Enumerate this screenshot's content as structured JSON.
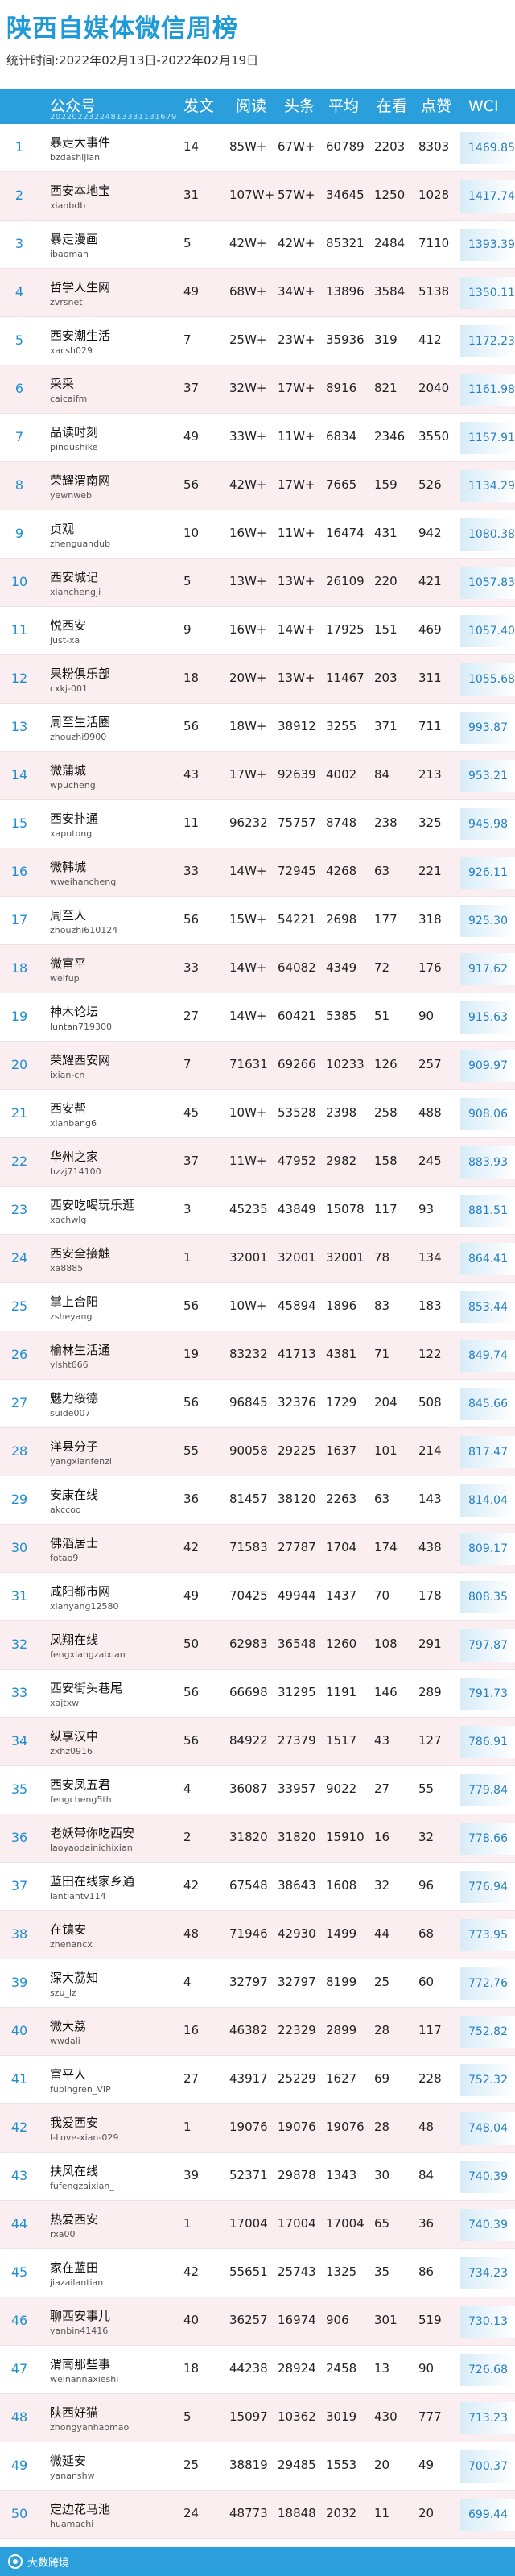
{
  "title": "陕西自媒体微信周榜",
  "subtitle": "统计时间:2022年02月13日-2022年02月19日",
  "header": {
    "account": "公众号",
    "account_sub": "20220223224813331131679",
    "posts": "发文",
    "reads": "阅读",
    "headline": "头条",
    "avg": "平均",
    "looking": "在看",
    "likes": "点赞",
    "wci": "WCI"
  },
  "rows": [
    {
      "rank": "1",
      "name": "暴走大事件",
      "id": "bzdashijian",
      "posts": "14",
      "reads": "85W+",
      "headline": "67W+",
      "avg": "60789",
      "looking": "2203",
      "likes": "8303",
      "wci": "1469.85"
    },
    {
      "rank": "2",
      "name": "西安本地宝",
      "id": "xianbdb",
      "posts": "31",
      "reads": "107W+",
      "headline": "57W+",
      "avg": "34645",
      "looking": "1250",
      "likes": "1028",
      "wci": "1417.74"
    },
    {
      "rank": "3",
      "name": "暴走漫画",
      "id": "ibaoman",
      "posts": "5",
      "reads": "42W+",
      "headline": "42W+",
      "avg": "85321",
      "looking": "2484",
      "likes": "7110",
      "wci": "1393.39"
    },
    {
      "rank": "4",
      "name": "哲学人生网",
      "id": "zvrsnet",
      "posts": "49",
      "reads": "68W+",
      "headline": "34W+",
      "avg": "13896",
      "looking": "3584",
      "likes": "5138",
      "wci": "1350.11"
    },
    {
      "rank": "5",
      "name": "西安潮生活",
      "id": "xacsh029",
      "posts": "7",
      "reads": "25W+",
      "headline": "23W+",
      "avg": "35936",
      "looking": "319",
      "likes": "412",
      "wci": "1172.23"
    },
    {
      "rank": "6",
      "name": "采采",
      "id": "caicaifm",
      "posts": "37",
      "reads": "32W+",
      "headline": "17W+",
      "avg": "8916",
      "looking": "821",
      "likes": "2040",
      "wci": "1161.98"
    },
    {
      "rank": "7",
      "name": "品读时刻",
      "id": "pindushike",
      "posts": "49",
      "reads": "33W+",
      "headline": "11W+",
      "avg": "6834",
      "looking": "2346",
      "likes": "3550",
      "wci": "1157.91"
    },
    {
      "rank": "8",
      "name": "荣耀渭南网",
      "id": "yewnweb",
      "posts": "56",
      "reads": "42W+",
      "headline": "17W+",
      "avg": "7665",
      "looking": "159",
      "likes": "526",
      "wci": "1134.29"
    },
    {
      "rank": "9",
      "name": "贞观",
      "id": "zhenguandub",
      "posts": "10",
      "reads": "16W+",
      "headline": "11W+",
      "avg": "16474",
      "looking": "431",
      "likes": "942",
      "wci": "1080.38"
    },
    {
      "rank": "10",
      "name": "西安城记",
      "id": "xianchengji",
      "posts": "5",
      "reads": "13W+",
      "headline": "13W+",
      "avg": "26109",
      "looking": "220",
      "likes": "421",
      "wci": "1057.83"
    },
    {
      "rank": "11",
      "name": "悦西安",
      "id": "just-xa",
      "posts": "9",
      "reads": "16W+",
      "headline": "14W+",
      "avg": "17925",
      "looking": "151",
      "likes": "469",
      "wci": "1057.40"
    },
    {
      "rank": "12",
      "name": "果粉俱乐部",
      "id": "cxkj-001",
      "posts": "18",
      "reads": "20W+",
      "headline": "13W+",
      "avg": "11467",
      "looking": "203",
      "likes": "311",
      "wci": "1055.68"
    },
    {
      "rank": "13",
      "name": "周至生活圈",
      "id": "zhouzhi9900",
      "posts": "56",
      "reads": "18W+",
      "headline": "38912",
      "avg": "3255",
      "looking": "371",
      "likes": "711",
      "wci": "993.87"
    },
    {
      "rank": "14",
      "name": "微蒲城",
      "id": "wpucheng",
      "posts": "43",
      "reads": "17W+",
      "headline": "92639",
      "avg": "4002",
      "looking": "84",
      "likes": "213",
      "wci": "953.21"
    },
    {
      "rank": "15",
      "name": "西安扑通",
      "id": "xaputong",
      "posts": "11",
      "reads": "96232",
      "headline": "75757",
      "avg": "8748",
      "looking": "238",
      "likes": "325",
      "wci": "945.98"
    },
    {
      "rank": "16",
      "name": "微韩城",
      "id": "wweihancheng",
      "posts": "33",
      "reads": "14W+",
      "headline": "72945",
      "avg": "4268",
      "looking": "63",
      "likes": "221",
      "wci": "926.11"
    },
    {
      "rank": "17",
      "name": "周至人",
      "id": "zhouzhi610124",
      "posts": "56",
      "reads": "15W+",
      "headline": "54221",
      "avg": "2698",
      "looking": "177",
      "likes": "318",
      "wci": "925.30"
    },
    {
      "rank": "18",
      "name": "微富平",
      "id": "weifup",
      "posts": "33",
      "reads": "14W+",
      "headline": "64082",
      "avg": "4349",
      "looking": "72",
      "likes": "176",
      "wci": "917.62"
    },
    {
      "rank": "19",
      "name": "神木论坛",
      "id": "luntan719300",
      "posts": "27",
      "reads": "14W+",
      "headline": "60421",
      "avg": "5385",
      "looking": "51",
      "likes": "90",
      "wci": "915.63"
    },
    {
      "rank": "20",
      "name": "荣耀西安网",
      "id": "ixian-cn",
      "posts": "7",
      "reads": "71631",
      "headline": "69266",
      "avg": "10233",
      "looking": "126",
      "likes": "257",
      "wci": "909.97"
    },
    {
      "rank": "21",
      "name": "西安帮",
      "id": "xianbang6",
      "posts": "45",
      "reads": "10W+",
      "headline": "53528",
      "avg": "2398",
      "looking": "258",
      "likes": "488",
      "wci": "908.06"
    },
    {
      "rank": "22",
      "name": "华州之家",
      "id": "hzzj714100",
      "posts": "37",
      "reads": "11W+",
      "headline": "47952",
      "avg": "2982",
      "looking": "158",
      "likes": "245",
      "wci": "883.93"
    },
    {
      "rank": "23",
      "name": "西安吃喝玩乐逛",
      "id": "xachwlg",
      "posts": "3",
      "reads": "45235",
      "headline": "43849",
      "avg": "15078",
      "looking": "117",
      "likes": "93",
      "wci": "881.51"
    },
    {
      "rank": "24",
      "name": "西安全接触",
      "id": "xa8885",
      "posts": "1",
      "reads": "32001",
      "headline": "32001",
      "avg": "32001",
      "looking": "78",
      "likes": "134",
      "wci": "864.41"
    },
    {
      "rank": "25",
      "name": "掌上合阳",
      "id": "zsheyang",
      "posts": "56",
      "reads": "10W+",
      "headline": "45894",
      "avg": "1896",
      "looking": "83",
      "likes": "183",
      "wci": "853.44"
    },
    {
      "rank": "26",
      "name": "榆林生活通",
      "id": "ylsht666",
      "posts": "19",
      "reads": "83232",
      "headline": "41713",
      "avg": "4381",
      "looking": "71",
      "likes": "122",
      "wci": "849.74"
    },
    {
      "rank": "27",
      "name": "魅力绥德",
      "id": "suide007",
      "posts": "56",
      "reads": "96845",
      "headline": "32376",
      "avg": "1729",
      "looking": "204",
      "likes": "508",
      "wci": "845.66"
    },
    {
      "rank": "28",
      "name": "洋县分子",
      "id": "yangxianfenzi",
      "posts": "55",
      "reads": "90058",
      "headline": "29225",
      "avg": "1637",
      "looking": "101",
      "likes": "214",
      "wci": "817.47"
    },
    {
      "rank": "29",
      "name": "安康在线",
      "id": "akccoo",
      "posts": "36",
      "reads": "81457",
      "headline": "38120",
      "avg": "2263",
      "looking": "63",
      "likes": "143",
      "wci": "814.04"
    },
    {
      "rank": "30",
      "name": "佛滔居士",
      "id": "fotao9",
      "posts": "42",
      "reads": "71583",
      "headline": "27787",
      "avg": "1704",
      "looking": "174",
      "likes": "438",
      "wci": "809.17"
    },
    {
      "rank": "31",
      "name": "咸阳都市网",
      "id": "xianyang12580",
      "posts": "49",
      "reads": "70425",
      "headline": "49944",
      "avg": "1437",
      "looking": "70",
      "likes": "178",
      "wci": "808.35"
    },
    {
      "rank": "32",
      "name": "凤翔在线",
      "id": "fengxiangzaixian",
      "posts": "50",
      "reads": "62983",
      "headline": "36548",
      "avg": "1260",
      "looking": "108",
      "likes": "291",
      "wci": "797.87"
    },
    {
      "rank": "33",
      "name": "西安街头巷尾",
      "id": "xajtxw",
      "posts": "56",
      "reads": "66698",
      "headline": "31295",
      "avg": "1191",
      "looking": "146",
      "likes": "289",
      "wci": "791.73"
    },
    {
      "rank": "34",
      "name": "纵享汉中",
      "id": "zxhz0916",
      "posts": "56",
      "reads": "84922",
      "headline": "27379",
      "avg": "1517",
      "looking": "43",
      "likes": "127",
      "wci": "786.91"
    },
    {
      "rank": "35",
      "name": "西安凤五君",
      "id": "fengcheng5th",
      "posts": "4",
      "reads": "36087",
      "headline": "33957",
      "avg": "9022",
      "looking": "27",
      "likes": "55",
      "wci": "779.84"
    },
    {
      "rank": "36",
      "name": "老妖带你吃西安",
      "id": "laoyaodainichixian",
      "posts": "2",
      "reads": "31820",
      "headline": "31820",
      "avg": "15910",
      "looking": "16",
      "likes": "32",
      "wci": "778.66"
    },
    {
      "rank": "37",
      "name": "蓝田在线家乡通",
      "id": "lantiantv114",
      "posts": "42",
      "reads": "67548",
      "headline": "38643",
      "avg": "1608",
      "looking": "32",
      "likes": "96",
      "wci": "776.94"
    },
    {
      "rank": "38",
      "name": "在镇安",
      "id": "zhenancx",
      "posts": "48",
      "reads": "71946",
      "headline": "42930",
      "avg": "1499",
      "looking": "44",
      "likes": "68",
      "wci": "773.95"
    },
    {
      "rank": "39",
      "name": "深大荔知",
      "id": "szu_lz",
      "posts": "4",
      "reads": "32797",
      "headline": "32797",
      "avg": "8199",
      "looking": "25",
      "likes": "60",
      "wci": "772.76"
    },
    {
      "rank": "40",
      "name": "微大荔",
      "id": "wwdali",
      "posts": "16",
      "reads": "46382",
      "headline": "22329",
      "avg": "2899",
      "looking": "28",
      "likes": "117",
      "wci": "752.82"
    },
    {
      "rank": "41",
      "name": "富平人",
      "id": "fupingren_VIP",
      "posts": "27",
      "reads": "43917",
      "headline": "25229",
      "avg": "1627",
      "looking": "69",
      "likes": "228",
      "wci": "752.32"
    },
    {
      "rank": "42",
      "name": "我爱西安",
      "id": "I-Love-xian-029",
      "posts": "1",
      "reads": "19076",
      "headline": "19076",
      "avg": "19076",
      "looking": "28",
      "likes": "48",
      "wci": "748.04"
    },
    {
      "rank": "43",
      "name": "扶风在线",
      "id": "fufengzaixian_",
      "posts": "39",
      "reads": "52371",
      "headline": "29878",
      "avg": "1343",
      "looking": "30",
      "likes": "84",
      "wci": "740.39"
    },
    {
      "rank": "44",
      "name": "热爱西安",
      "id": "rxa00",
      "posts": "1",
      "reads": "17004",
      "headline": "17004",
      "avg": "17004",
      "looking": "65",
      "likes": "36",
      "wci": "740.39"
    },
    {
      "rank": "45",
      "name": "家在蓝田",
      "id": "jiazailantian",
      "posts": "42",
      "reads": "55651",
      "headline": "25743",
      "avg": "1325",
      "looking": "35",
      "likes": "86",
      "wci": "734.23"
    },
    {
      "rank": "46",
      "name": "聊西安事儿",
      "id": "yanbin41416",
      "posts": "40",
      "reads": "36257",
      "headline": "16974",
      "avg": "906",
      "looking": "301",
      "likes": "519",
      "wci": "730.13"
    },
    {
      "rank": "47",
      "name": "渭南那些事",
      "id": "weinannaxieshi",
      "posts": "18",
      "reads": "44238",
      "headline": "28924",
      "avg": "2458",
      "looking": "13",
      "likes": "90",
      "wci": "726.68"
    },
    {
      "rank": "48",
      "name": "陕西好猫",
      "id": "zhongyanhaomao",
      "posts": "5",
      "reads": "15097",
      "headline": "10362",
      "avg": "3019",
      "looking": "430",
      "likes": "777",
      "wci": "713.23"
    },
    {
      "rank": "49",
      "name": "微延安",
      "id": "yananshw",
      "posts": "25",
      "reads": "38819",
      "headline": "29485",
      "avg": "1553",
      "looking": "20",
      "likes": "49",
      "wci": "700.37"
    },
    {
      "rank": "50",
      "name": "定边花马池",
      "id": "huamachi",
      "posts": "24",
      "reads": "48773",
      "headline": "18848",
      "avg": "2032",
      "looking": "11",
      "likes": "20",
      "wci": "699.44"
    }
  ],
  "footer": {
    "brand": "大数跨境"
  }
}
